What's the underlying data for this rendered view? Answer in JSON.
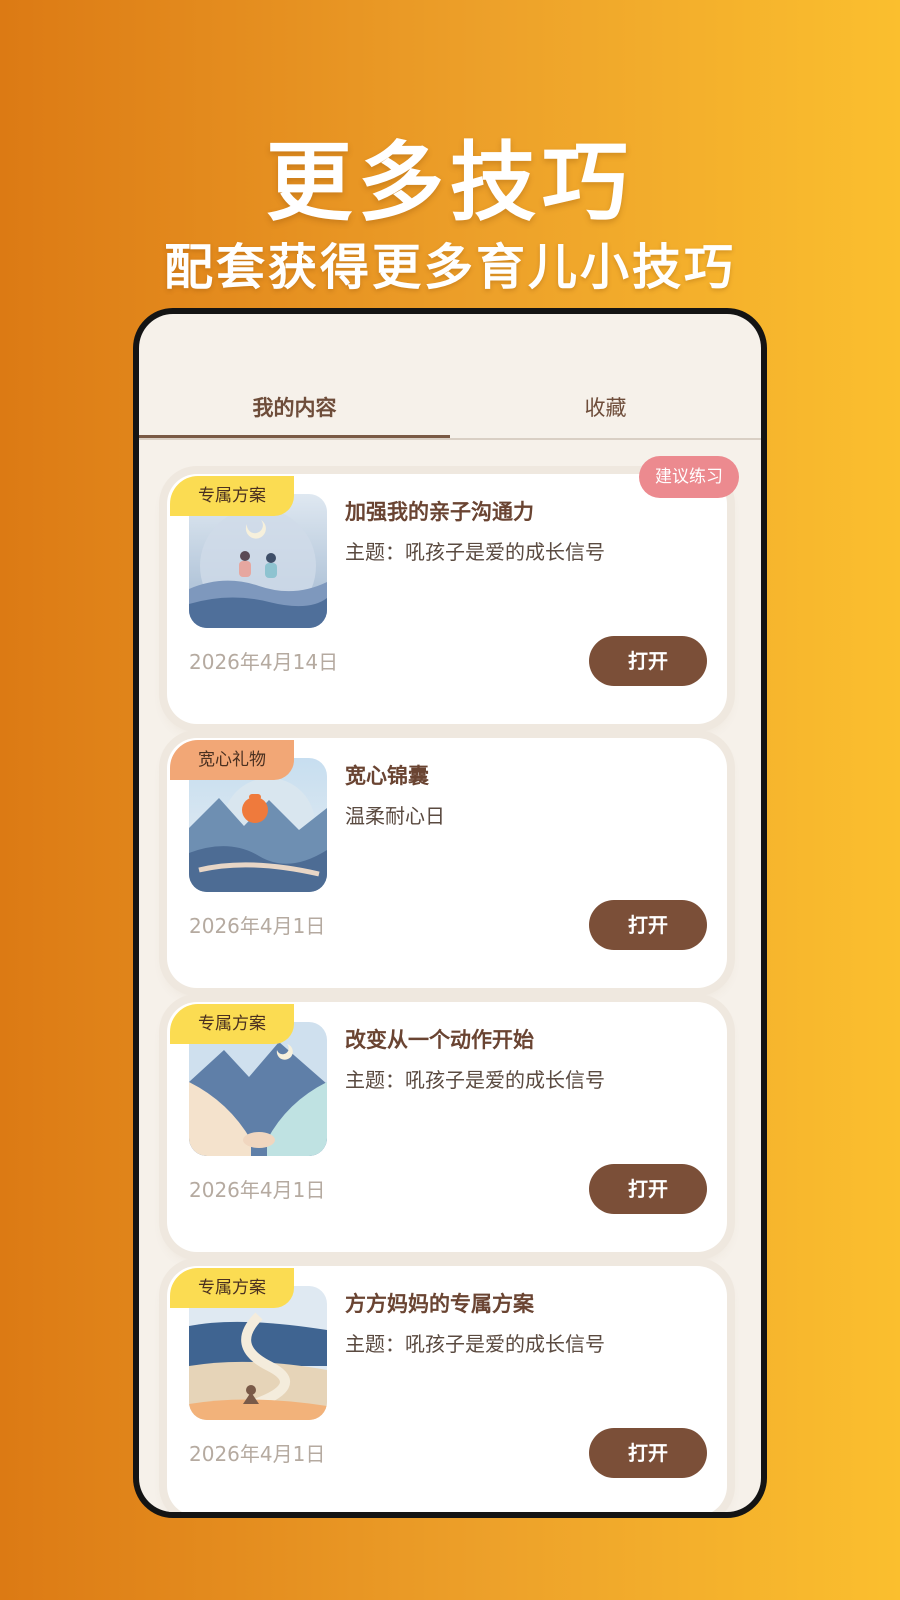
{
  "promo": {
    "headline": "更多技巧",
    "subheadline": "配套获得更多育儿小技巧"
  },
  "tabs": [
    {
      "label": "我的内容",
      "active": true
    },
    {
      "label": "收藏",
      "active": false
    }
  ],
  "cards": [
    {
      "tag": "专属方案",
      "title": "加强我的亲子沟通力",
      "subtitle": "主题：吼孩子是爱的成长信号",
      "date": "2026年4月14日",
      "open_label": "打开",
      "badge": "建议练习"
    },
    {
      "tag": "宽心礼物",
      "title": "宽心锦囊",
      "subtitle": "温柔耐心日",
      "date": "2026年4月1日",
      "open_label": "打开"
    },
    {
      "tag": "专属方案",
      "title": "改变从一个动作开始",
      "subtitle": "主题：吼孩子是爱的成长信号",
      "date": "2026年4月1日",
      "open_label": "打开"
    },
    {
      "tag": "专属方案",
      "title": "方方妈妈的专属方案",
      "subtitle": "主题：吼孩子是爱的成长信号",
      "date": "2026年4月1日",
      "open_label": "打开"
    }
  ],
  "colors": {
    "accent_brown": "#7b4f38",
    "tag_yellow": "#fbdc52",
    "tag_orange": "#f2a776",
    "badge_pink": "#ec8a8f"
  }
}
